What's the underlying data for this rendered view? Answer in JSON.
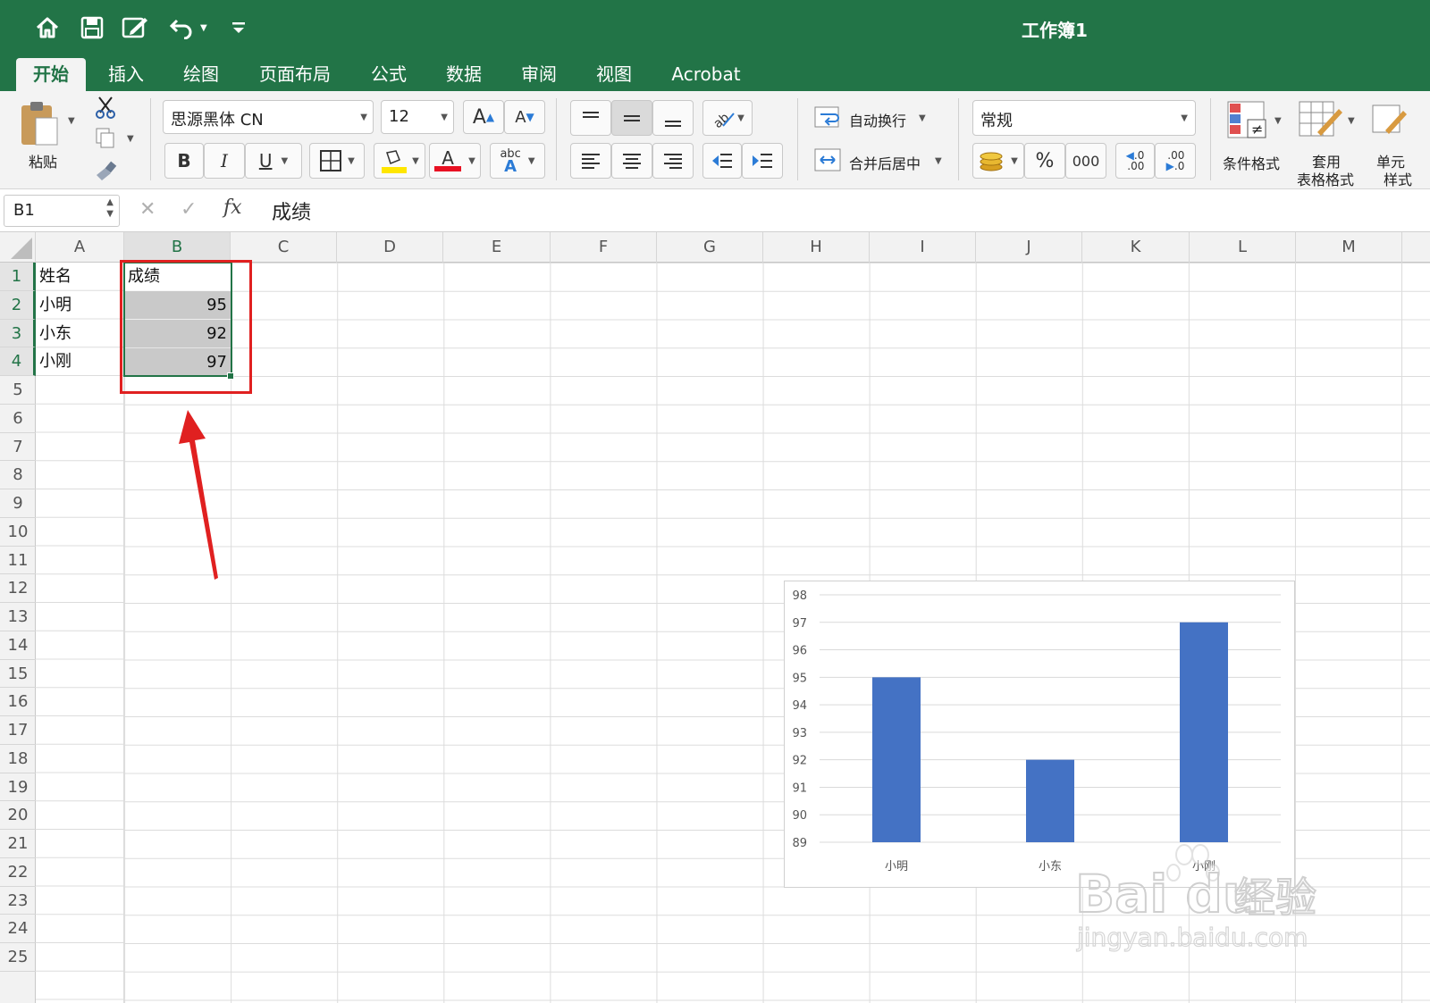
{
  "window": {
    "title": "工作簿1"
  },
  "quick_access": {
    "icons": [
      "home-icon",
      "save-icon",
      "edit-icon",
      "undo-icon",
      "customize-icon"
    ]
  },
  "tabs": [
    {
      "label": "开始",
      "active": true
    },
    {
      "label": "插入"
    },
    {
      "label": "绘图"
    },
    {
      "label": "页面布局"
    },
    {
      "label": "公式"
    },
    {
      "label": "数据"
    },
    {
      "label": "审阅"
    },
    {
      "label": "视图"
    },
    {
      "label": "Acrobat"
    }
  ],
  "ribbon": {
    "paste_label": "粘贴",
    "font_name": "思源黑体 CN",
    "font_size": "12",
    "bold": "B",
    "italic": "I",
    "underline": "U",
    "grow_font": "A",
    "shrink_font": "A",
    "font_color_letter": "A",
    "phonetic_top": "abc",
    "phonetic_bottom": "A",
    "wrap_text": "自动换行",
    "merge_center": "合并后居中",
    "number_format": "常规",
    "percent": "%",
    "thousands": "000",
    "inc_decimal_top": ".0",
    "inc_decimal_bottom": ".00",
    "dec_decimal_top": ".00",
    "dec_decimal_bottom": ".0",
    "conditional_format": "条件格式",
    "table_format_line1": "套用",
    "table_format_line2": "表格格式",
    "cell_styles_line1": "单元",
    "cell_styles_line2": "样式",
    "colors": {
      "highlight": "#ffe600",
      "font_red": "#e81123",
      "accent": "#227447"
    }
  },
  "formula_bar": {
    "cell_ref": "B1",
    "cancel": "✕",
    "confirm": "✓",
    "fx": "fx",
    "content": "成绩"
  },
  "sheet": {
    "columns": [
      "A",
      "B",
      "C",
      "D",
      "E",
      "F",
      "G",
      "H",
      "I",
      "J",
      "K",
      "L",
      "M"
    ],
    "selected_column": "B",
    "rows": [
      "1",
      "2",
      "3",
      "4",
      "5",
      "6",
      "7",
      "8",
      "9",
      "10",
      "11",
      "12",
      "13",
      "14",
      "15",
      "16",
      "17",
      "18",
      "19",
      "20",
      "21",
      "22",
      "23",
      "24",
      "25"
    ],
    "selected_rows": [
      "1",
      "2",
      "3",
      "4"
    ],
    "cells": {
      "A1": "姓名",
      "B1": "成绩",
      "A2": "小明",
      "B2": "95",
      "A3": "小东",
      "B3": "92",
      "A4": "小刚",
      "B4": "97"
    },
    "annotation_color": "#e02020"
  },
  "chart_data": {
    "type": "bar",
    "categories": [
      "小明",
      "小东",
      "小刚"
    ],
    "values": [
      95,
      92,
      97
    ],
    "ylim": [
      89,
      98
    ],
    "yticks": [
      89,
      90,
      91,
      92,
      93,
      94,
      95,
      96,
      97,
      98
    ],
    "title": "",
    "xlabel": "",
    "ylabel": "",
    "grid": true,
    "bar_color": "#4472c4"
  },
  "watermark": {
    "brand": "Bai du",
    "cn": "经验",
    "url": "jingyan.baidu.com"
  }
}
